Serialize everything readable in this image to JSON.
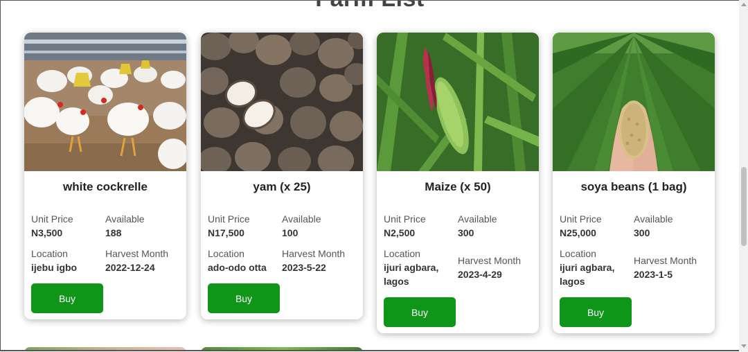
{
  "page": {
    "title": "Farm List"
  },
  "labels": {
    "unit_price": "Unit Price",
    "available": "Available",
    "location": "Location",
    "harvest_month": "Harvest Month",
    "buy": "Buy"
  },
  "products": [
    {
      "name": "white cockrelle",
      "unit_price": "N3,500",
      "available": "188",
      "location": "ijebu igbo",
      "harvest_month": "2022-12-24",
      "image_icon": "chickens-photo"
    },
    {
      "name": "yam (x 25)",
      "unit_price": "N17,500",
      "available": "100",
      "location": "ado-odo otta",
      "harvest_month": "2023-5-22",
      "image_icon": "yam-photo"
    },
    {
      "name": "Maize (x 50)",
      "unit_price": "N2,500",
      "available": "300",
      "location": "ijuri agbara, lagos",
      "harvest_month": "2023-4-29",
      "image_icon": "maize-photo"
    },
    {
      "name": "soya beans (1 bag)",
      "unit_price": "N25,000",
      "available": "300",
      "location": "ijuri agbara, lagos",
      "harvest_month": "2023-1-5",
      "image_icon": "soya-field-photo"
    }
  ],
  "colors": {
    "buy_button": "#0f9618",
    "title": "#444444"
  }
}
